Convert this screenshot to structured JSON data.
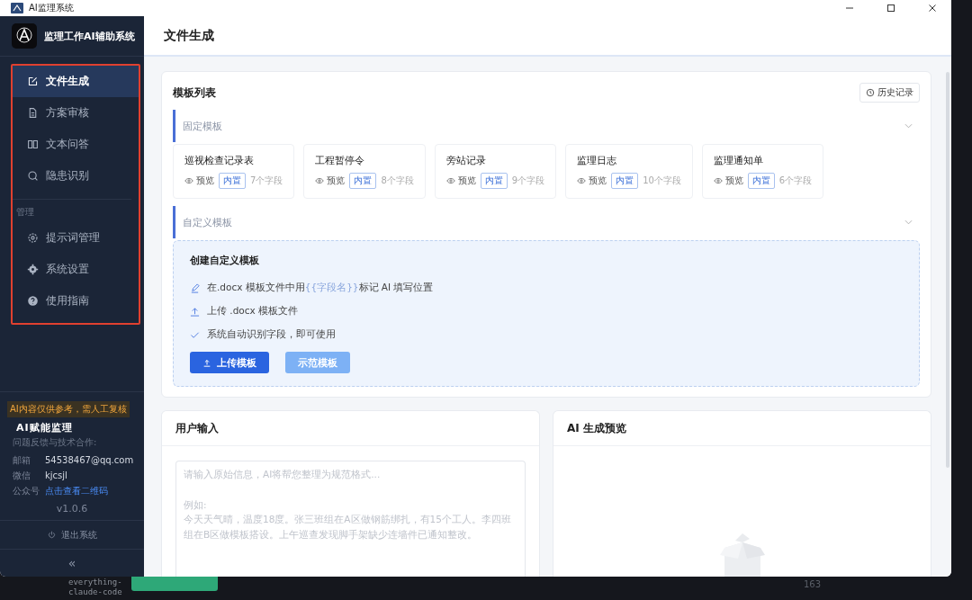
{
  "window": {
    "title": "AI监理系统"
  },
  "sidebar": {
    "app_name": "监理工作AI辅助系统",
    "items": [
      {
        "label": "文件生成",
        "selected": true
      },
      {
        "label": "方案审核",
        "selected": false
      },
      {
        "label": "文本问答",
        "selected": false
      },
      {
        "label": "隐患识别",
        "selected": false
      }
    ],
    "section_label": "管理",
    "admin_items": [
      {
        "label": "提示词管理",
        "selected": false
      },
      {
        "label": "系统设置",
        "selected": false
      },
      {
        "label": "使用指南",
        "selected": false
      }
    ],
    "notice": "AI内容仅供参考，需人工复核",
    "brand": "AI赋能监理",
    "contact_heading": "问题反馈与技术合作:",
    "contacts": [
      {
        "label": "邮箱",
        "value": "54538467@qq.com",
        "kind": "text"
      },
      {
        "label": "微信",
        "value": "kjcsjl",
        "kind": "text"
      },
      {
        "label": "公众号",
        "value": "点击查看二维码",
        "kind": "link"
      }
    ],
    "version": "v1.0.6",
    "logout": "退出系统",
    "collapse": "«"
  },
  "page_title": "文件生成",
  "template_list": {
    "title": "模板列表",
    "history_button": "历史记录",
    "fixed_section": "固定模板",
    "templates": [
      {
        "name": "巡视检查记录表",
        "preview": "预览",
        "tag": "内置",
        "fields": "7个字段"
      },
      {
        "name": "工程暂停令",
        "preview": "预览",
        "tag": "内置",
        "fields": "8个字段"
      },
      {
        "name": "旁站记录",
        "preview": "预览",
        "tag": "内置",
        "fields": "9个字段"
      },
      {
        "name": "监理日志",
        "preview": "预览",
        "tag": "内置",
        "fields": "10个字段"
      },
      {
        "name": "监理通知单",
        "preview": "预览",
        "tag": "内置",
        "fields": "6个字段"
      }
    ],
    "custom_section": "自定义模板",
    "custom_panel": {
      "title": "创建自定义模板",
      "steps": [
        {
          "kind": "pen",
          "before": "在.docx 模板文件中用",
          "code": "{{字段名}}",
          "after": "标记 AI 填写位置"
        },
        {
          "kind": "upload",
          "before": "上传 .docx 模板文件"
        },
        {
          "kind": "check",
          "before": "系统自动识别字段，即可使用"
        }
      ],
      "buttons": [
        {
          "label": "上传模板",
          "kind": "primary"
        },
        {
          "label": "示范模板",
          "kind": "secondary"
        }
      ]
    }
  },
  "user_input": {
    "title": "用户输入",
    "placeholder": "请输入原始信息，AI将帮您整理为规范格式...\n\n例如:\n今天天气晴，温度18度。张三班组在A区做钢筋绑扎，有15个工人。李四班组在B区做模板搭设。上午巡查发现脚手架缺少连墙件已通知整改。"
  },
  "preview": {
    "title": "AI 生成预览"
  },
  "terminal": {
    "lines": [
      "everything-",
      "claude-code"
    ],
    "number": "163"
  }
}
